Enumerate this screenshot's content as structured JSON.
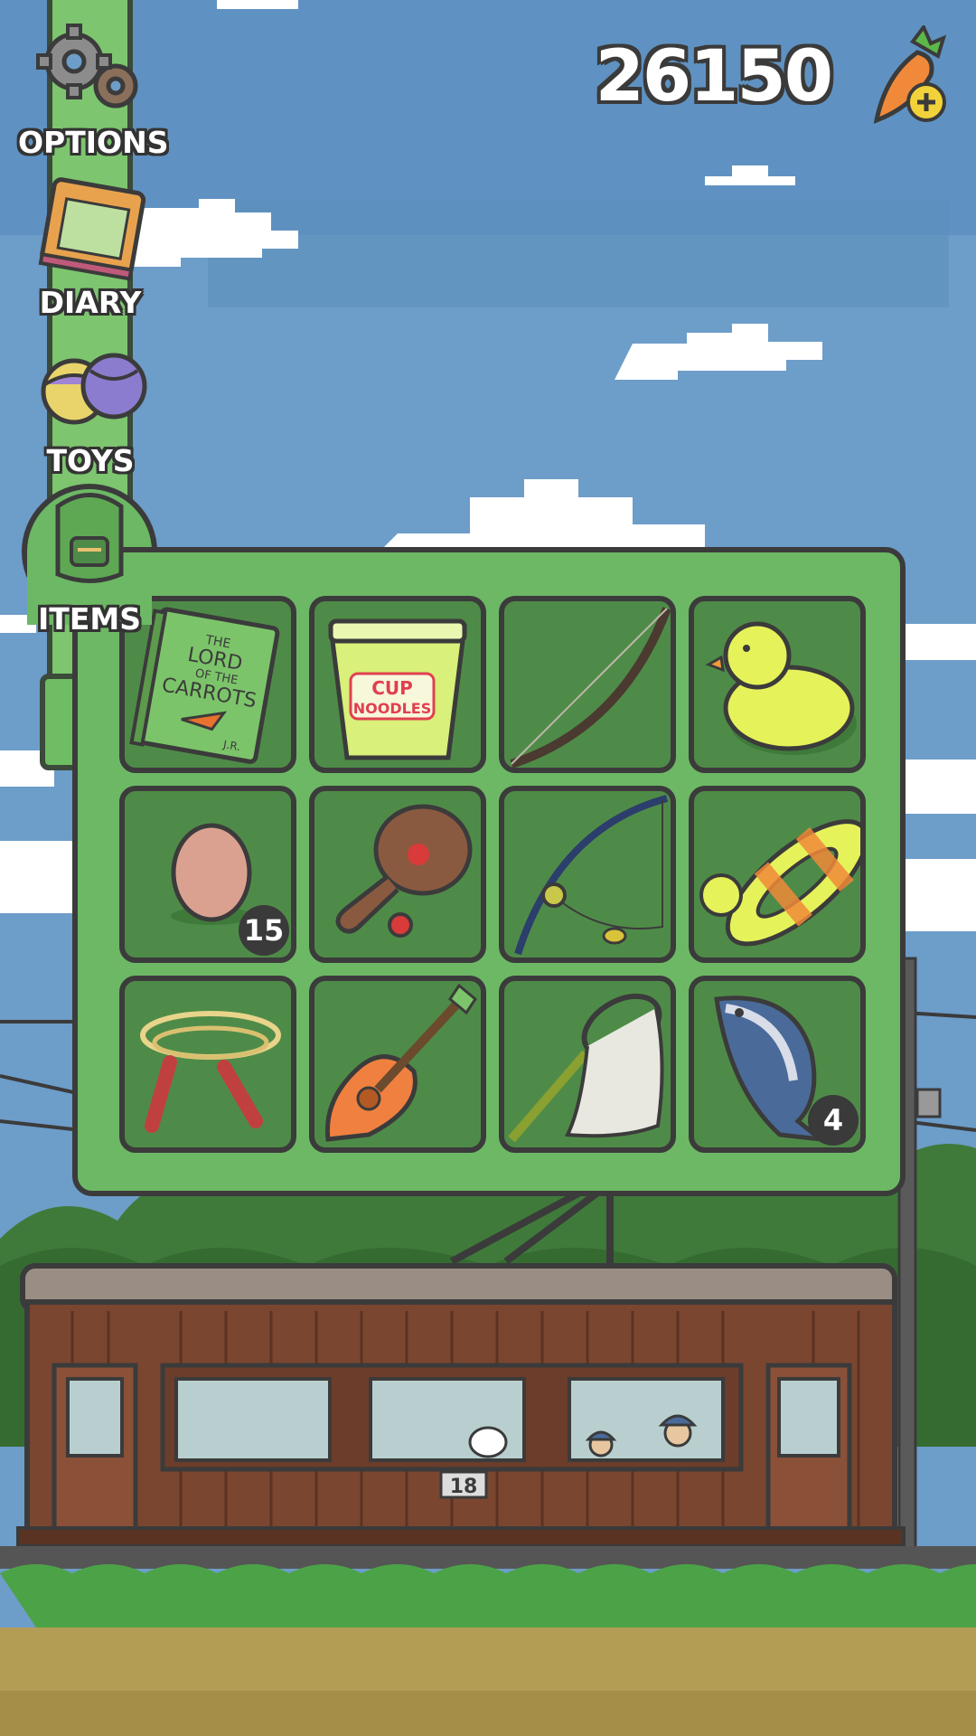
{
  "menu": {
    "items": [
      {
        "label": "OPTIONS",
        "icon": "gears-icon"
      },
      {
        "label": "DIARY",
        "icon": "diary-book-icon"
      },
      {
        "label": "TOYS",
        "icon": "toy-balls-icon"
      },
      {
        "label": "ITEMS",
        "icon": "backpack-icon"
      }
    ]
  },
  "currency": {
    "value": "26150",
    "icon": "carrot-plus-icon"
  },
  "items_panel": {
    "slots": [
      {
        "name": "lord-of-the-carrots-book",
        "book_title_lines": [
          "THE",
          "LORD",
          "OF THE",
          "CARROTS"
        ],
        "book_author": "J.R."
      },
      {
        "name": "cup-noodles",
        "label_lines": [
          "CUP",
          "NOODLES"
        ]
      },
      {
        "name": "bow"
      },
      {
        "name": "rubber-duck"
      },
      {
        "name": "egg",
        "count": "15"
      },
      {
        "name": "paddle-ball"
      },
      {
        "name": "fishing-rod"
      },
      {
        "name": "duck-swim-ring"
      },
      {
        "name": "jump-rope"
      },
      {
        "name": "carrot-ukulele"
      },
      {
        "name": "bug-net"
      },
      {
        "name": "tuna-fish",
        "count": "4"
      }
    ]
  },
  "scene": {
    "train_number": "18"
  },
  "colors": {
    "sky": "#6d9dc9",
    "panel_green": "#6db865",
    "slot_green": "#4f8b48",
    "outline": "#3b3b3b",
    "train_brown": "#7a4630"
  }
}
